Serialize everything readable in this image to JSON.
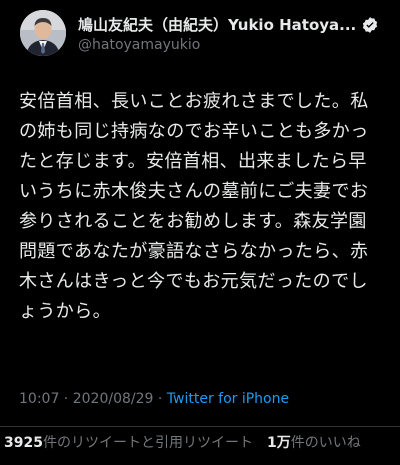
{
  "user": {
    "display_name": "鳩山友紀夫（由紀夫）Yukio Hatoya...",
    "handle": "@hatoyamayukio"
  },
  "tweet": {
    "text": "安倍首相、長いことお疲れさまでした。私の姉も同じ持病なのでお辛いことも多かったと存じます。安倍首相、出来ましたら早いうちに赤木俊夫さんの墓前にご夫妻でお参りされることをお勧めします。森友学園問題であなたが豪語なさらなかったら、赤木さんはきっと今でもお元気だったのでしょうから。",
    "time": "10:07",
    "separator": " · ",
    "date": "2020/08/29",
    "source": "Twitter for iPhone"
  },
  "stats": {
    "retweets_count": "3925",
    "retweets_label": "件のリツイートと引用リツイート",
    "likes_count": "1万",
    "likes_label": "件のいいね"
  },
  "colors": {
    "background": "#000000",
    "text": "#e7e9ea",
    "secondary": "#71767b",
    "link": "#1d9bf0",
    "verified_badge": "#e7e9ea"
  },
  "icons": {
    "verified": "verified-badge-icon",
    "avatar": "profile-photo"
  }
}
